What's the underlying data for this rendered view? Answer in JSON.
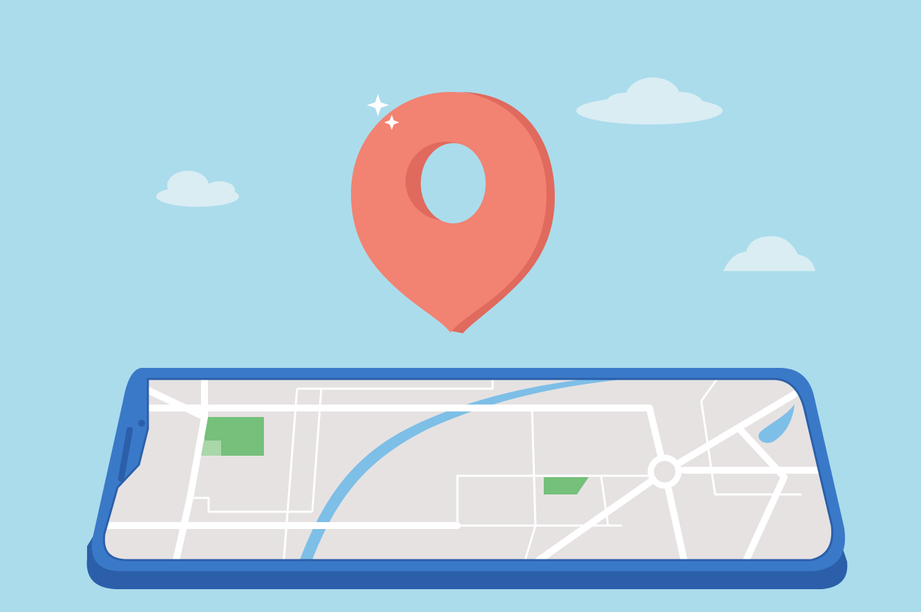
{
  "colors": {
    "sky": "#abdcec",
    "cloud": "#d9edf3",
    "pin": "#f28271",
    "pin_side": "#df6a5d",
    "phone_blue": "#3a79c8",
    "phone_dark": "#2b5faa",
    "map_ground": "#e6e2e2",
    "road": "#ffffff",
    "river": "#7ebfe7",
    "park": "#75c07a",
    "park_light": "#a9d7a8",
    "sparkle": "#ffffff"
  },
  "icons": {
    "location_pin": "location-pin-icon",
    "sparkle": "sparkle-icon",
    "phone": "smartphone-icon",
    "map": "city-map-icon"
  }
}
